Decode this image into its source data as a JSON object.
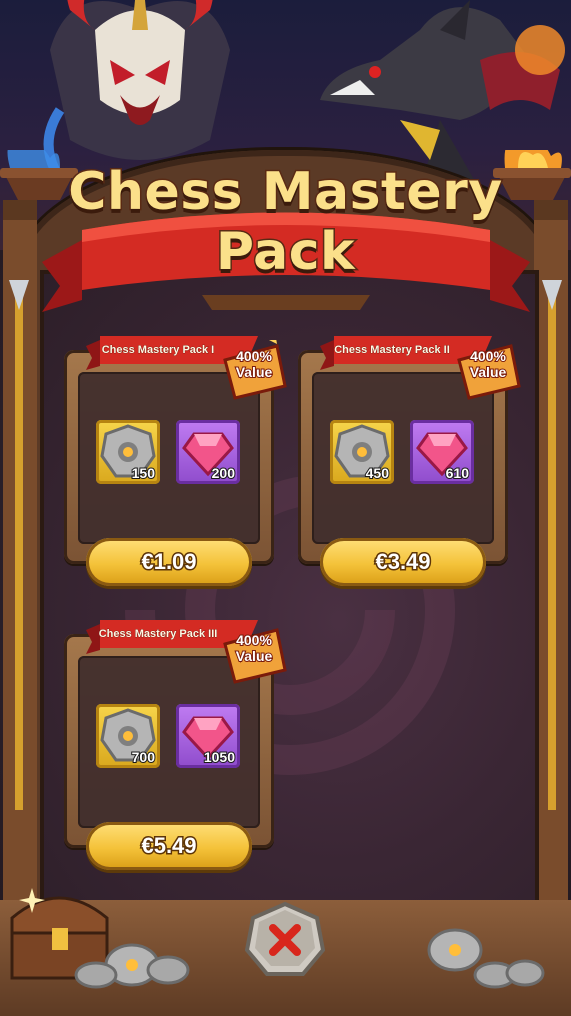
{
  "title": {
    "line1": "Chess Mastery",
    "line2": "Pack"
  },
  "packs": [
    {
      "name": "Chess Mastery Pack I",
      "badge": {
        "line1": "400%",
        "line2": "Value"
      },
      "items": [
        {
          "icon": "chess-token-icon",
          "count": "150"
        },
        {
          "icon": "gem-icon",
          "count": "200"
        }
      ],
      "price": "€1.09"
    },
    {
      "name": "Chess Mastery Pack II",
      "badge": {
        "line1": "400%",
        "line2": "Value"
      },
      "items": [
        {
          "icon": "chess-token-icon",
          "count": "450"
        },
        {
          "icon": "gem-icon",
          "count": "610"
        }
      ],
      "price": "€3.49"
    },
    {
      "name": "Chess Mastery Pack III",
      "badge": {
        "line1": "400%",
        "line2": "Value"
      },
      "items": [
        {
          "icon": "chess-token-icon",
          "count": "700"
        },
        {
          "icon": "gem-icon",
          "count": "1050"
        }
      ],
      "price": "€5.49"
    }
  ],
  "colors": {
    "title": "#fbe08a",
    "banner": "#d42b23",
    "price_button": "#f4c239",
    "item_coin_bg": "#f7d54b",
    "item_gem_bg": "#a862e0",
    "badge": "#f0a23a"
  }
}
